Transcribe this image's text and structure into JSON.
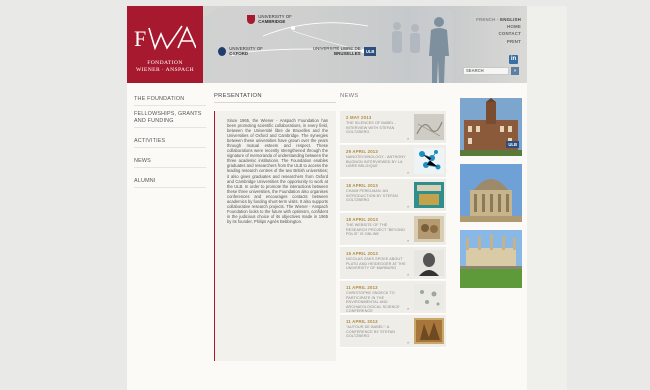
{
  "logo": {
    "line1": "FONDATION",
    "line2": "WIENER · ANSPACH"
  },
  "universities": [
    {
      "name_top": "UNIVERSITY OF",
      "name": "CAMBRIDGE"
    },
    {
      "name_top": "UNIVERSITY OF",
      "name": "OXFORD"
    },
    {
      "name_top": "UNIVERSITÉ LIBRE DE",
      "name": "BRUXELLES",
      "badge": "ULB"
    }
  ],
  "topnav": {
    "french": "FRENCH",
    "sep": " - ",
    "english": "ENGLISH",
    "home": "HOME",
    "contact": "CONTACT",
    "print": "PRINT"
  },
  "search": {
    "placeholder": "SEARCH",
    "button": "»"
  },
  "leftnav": [
    "THE FOUNDATION",
    "FELLOWSHIPS, GRANTS AND FUNDING",
    "ACTIVITIES",
    "NEWS",
    "ALUMNI"
  ],
  "presentation": {
    "heading": "PRESENTATION",
    "body": "Since 1965, the Wiener - Anspach Foundation has been promoting scientific collaborations, in every field, between the Université libre de Bruxelles and the Universities of Oxford and Cambridge. The synergies between these universities have grown over the years through mutual esteem and respect. These collaborations were recently strengthened through the signature of memoranda of understanding between the three academic institutions. The Foundation enables graduates and researchers from the ULB to access the leading research centres of the two British universities; it also gives graduates and researchers from Oxford and Cambridge Universities the opportunity to work at the ULB. In order to promote the interactions between these three universities, the Foundation also organises conferences and encourages contacts between academics by funding short-term visits. It also supports collaborative research projects. The Wiener - Anspach Foundation looks to the future with optimism, confident in the judicious choice of its objectives made in 1965 by its founder, Philips Agnès Bebbington."
  },
  "news": {
    "heading": "NEWS",
    "items": [
      {
        "date": "2 MAY 2013",
        "title": "THE SILENCES OF BABEL - INTERVIEW WITH STEFAN GOLTZBERG",
        "more": "»"
      },
      {
        "date": "29 APRIL 2013",
        "title": "NANOTECHNOLOGY : ANTHONY BUGNON INTERVIEWED BY LA LIBRE BELGIQUE",
        "more": "»"
      },
      {
        "date": "18 APRIL 2013",
        "title": "CHAIM PERELMAN: AN INTRODUCTION BY STEFAN GOLTZBERG",
        "more": "»"
      },
      {
        "date": "18 APRIL 2013",
        "title": "THE WEBSITE OF THE RESEARCH PROJECT \"BEYOND POLIS\" IS ONLINE",
        "more": "»"
      },
      {
        "date": "15 APRIL 2013",
        "title": "NICOLAS ZAKS SPOKE ABOUT PLATO AND HEIDEGGER AT THE UNIVERSITY OF MARBURG",
        "more": "»"
      },
      {
        "date": "11 APRIL 2013",
        "title": "CHRISTOPHE SNOECK TO PARTICIPATE IN THE ENVIRONMENTAL AND ARCHAEOLOGICAL SCIENCE CONFERENCE",
        "more": "»"
      },
      {
        "date": "11 APRIL 2013",
        "title": "\"AUTOUR DE BABEL\": A CONFERENCE BY STEFAN GOLTZBERG",
        "more": "»"
      }
    ]
  },
  "photos": [
    {
      "caption": "ULB building",
      "badge": "ULB"
    },
    {
      "caption": "Radcliffe Camera, Oxford"
    },
    {
      "caption": "King's College, Cambridge"
    }
  ],
  "colors": {
    "brand_red": "#a7192e",
    "news_date": "#b08a40",
    "link_blue": "#3a6fa6"
  }
}
